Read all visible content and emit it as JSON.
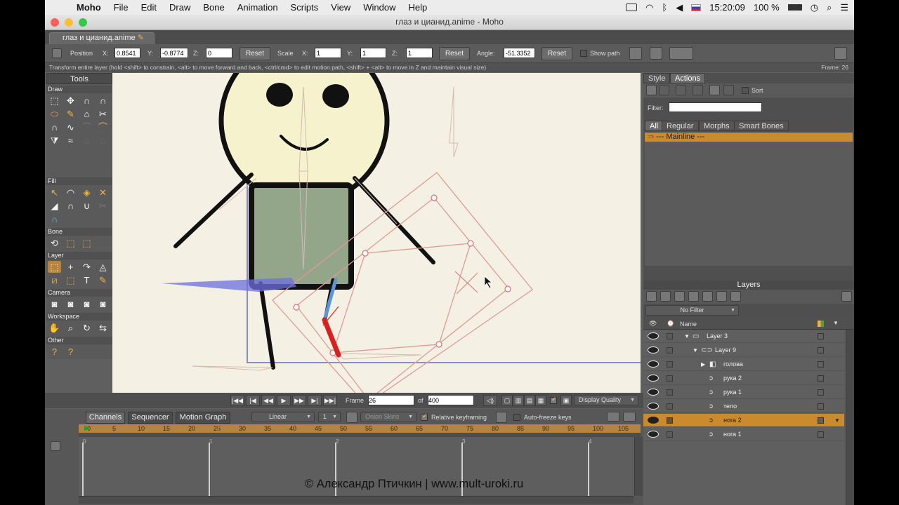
{
  "menubar": {
    "app": "Moho",
    "items": [
      "File",
      "Edit",
      "Draw",
      "Bone",
      "Animation",
      "Scripts",
      "View",
      "Window",
      "Help"
    ],
    "clock": "15:20:09",
    "battery": "100 %"
  },
  "window": {
    "title": "глаз и цианид.anime - Moho",
    "doc_tab": "глаз и цианид.anime"
  },
  "toolbar": {
    "position_label": "Position",
    "x_label": "X:",
    "y_label": "Y:",
    "z_label": "Z:",
    "pos_x": "0.8541",
    "pos_y": "-0.8774",
    "pos_z": "0",
    "reset1": "Reset",
    "scale_label": "Scale",
    "scale_x": "1",
    "scale_y": "1",
    "scale_z": "1",
    "reset2": "Reset",
    "angle_label": "Angle:",
    "angle": "-51.3352",
    "reset3": "Reset",
    "show_path": "Show path"
  },
  "status": {
    "hint": "Transform entire layer (hold <shift> to constrain, <alt> to move forward and back, <ctrl/cmd> to edit motion path, <shift> + <alt> to move in Z and maintain visual size)",
    "frame": "Frame: 26"
  },
  "tools": {
    "title": "Tools",
    "sections": [
      "Draw",
      "Fill",
      "Bone",
      "Layer",
      "Camera",
      "Workspace",
      "Other"
    ]
  },
  "transport": {
    "frame_label": "Frame",
    "frame": "26",
    "of_label": "of",
    "total": "400",
    "display_quality": "Display Quality"
  },
  "timeline": {
    "tabs": [
      "Channels",
      "Sequencer",
      "Motion Graph"
    ],
    "interp": "Linear",
    "interp_num": "1",
    "onion": "Onion Skins",
    "relative_kf": "Relative keyframing",
    "auto_freeze": "Auto-freeze keys",
    "ruler": [
      "0",
      "5",
      "10",
      "15",
      "20",
      "25",
      "30",
      "35",
      "40",
      "45",
      "50",
      "55",
      "60",
      "65",
      "70",
      "75",
      "80",
      "85",
      "90",
      "95",
      "100",
      "105"
    ],
    "sub_ruler": [
      "0",
      "1",
      "2",
      "3",
      "4"
    ],
    "current_frame": 26
  },
  "watermark": "© Александр Птичкин | www.mult-uroki.ru",
  "right_panel": {
    "tabs": [
      "Style",
      "Actions"
    ],
    "sort": "Sort",
    "filter_label": "Filter:",
    "action_tabs": [
      "All",
      "Regular",
      "Morphs",
      "Smart Bones"
    ],
    "mainline": "--- Mainline ---",
    "layers_title": "Layers",
    "no_filter": "No Filter",
    "name_col": "Name",
    "layers": [
      {
        "name": "Layer 3",
        "indent": 0,
        "type": "folder",
        "twist": "▼",
        "selected": false
      },
      {
        "name": "Layer 9",
        "indent": 1,
        "type": "bone",
        "twist": "▼",
        "selected": false
      },
      {
        "name": "голова",
        "indent": 2,
        "type": "group",
        "twist": "▶",
        "selected": false
      },
      {
        "name": "рука 2",
        "indent": 2,
        "type": "vector",
        "twist": "",
        "selected": false
      },
      {
        "name": "рука 1",
        "indent": 2,
        "type": "vector",
        "twist": "",
        "selected": false
      },
      {
        "name": "тело",
        "indent": 2,
        "type": "vector",
        "twist": "",
        "selected": false
      },
      {
        "name": "нога 2",
        "indent": 2,
        "type": "vector",
        "twist": "",
        "selected": true
      },
      {
        "name": "нога 1",
        "indent": 2,
        "type": "vector",
        "twist": "",
        "selected": false
      }
    ]
  }
}
